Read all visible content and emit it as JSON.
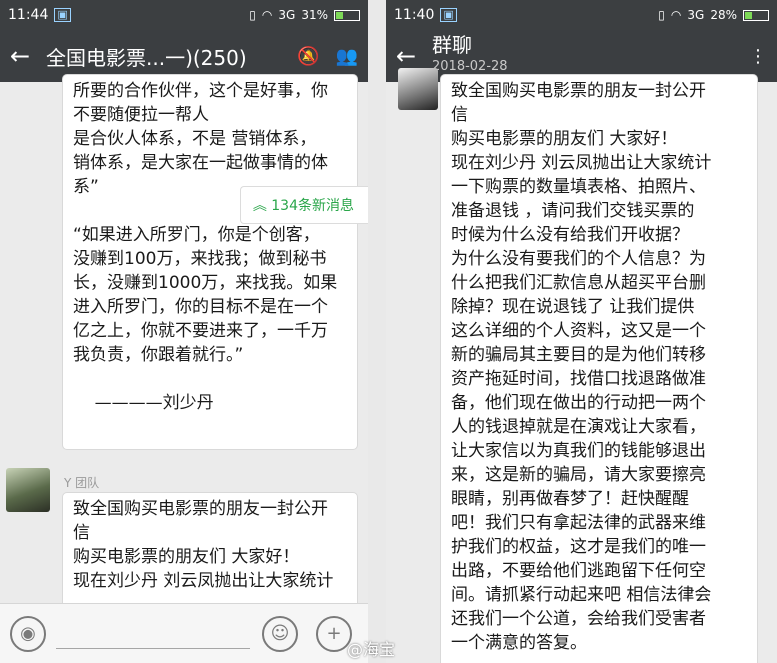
{
  "left": {
    "status": {
      "time": "11:44",
      "signal": "3G",
      "battery": "31%",
      "battery_level": 0.31
    },
    "header": {
      "title": "全国电影票...一)",
      "count": "(250)"
    },
    "new_messages": "134条新消息",
    "quote_text": "所要的合作伙伴，这个是好事，你\n不要随便拉一帮人\n是合伙人体系，不是 营销体系，\n销体系，是大家在一起做事情的体\n系”\n\n“如果进入所罗门，你是个创客，\n没赚到100万，来找我；做到秘书\n长，没赚到1000万，来找我。如果\n进入所罗门，你的目标不是在一个\n亿之上，你就不要进来了，一千万\n我负责，你跟着就行。”\n\n    ————刘少丹",
    "sender": "Y 团队",
    "letter_text": "致全国购买电影票的朋友一封公开\n信\n购买电影票的朋友们 大家好！\n现在刘少丹 刘云凤抛出让大家统计"
  },
  "right": {
    "status": {
      "time": "11:40",
      "signal": "3G",
      "battery": "28%",
      "battery_level": 0.28
    },
    "header": {
      "title": "群聊",
      "date": "2018-02-28"
    },
    "letter_text": "致全国购买电影票的朋友一封公开\n信\n购买电影票的朋友们 大家好！\n现在刘少丹 刘云凤抛出让大家统计\n一下购票的数量填表格、拍照片、\n准备退钱 ，请问我们交钱买票的\n时候为什么没有给我们开收据？\n为什么没有要我们的个人信息？为\n什么把我们汇款信息从超买平台删\n除掉？现在说退钱了 让我们提供\n这么详细的个人资料，这又是一个\n新的骗局其主要目的是为他们转移\n资产拖延时间，找借口找退路做准\n备，他们现在做出的行动把一两个\n人的钱退掉就是在演戏让大家看，\n让大家信以为真我们的钱能够退出\n来，这是新的骗局，请大家要擦亮\n眼睛，别再做春梦了！赶快醒醒\n吧！我们只有拿起法律的武器来维\n护我们的权益，这才是我们的唯一\n出路，不要给他们逃跑留下任何空\n间。请抓紧行动起来吧 相信法律会\n还我们一个公道，会给我们受害者\n一个满意的答复。\n\n创客维权中心"
  },
  "watermark": "@海宝"
}
